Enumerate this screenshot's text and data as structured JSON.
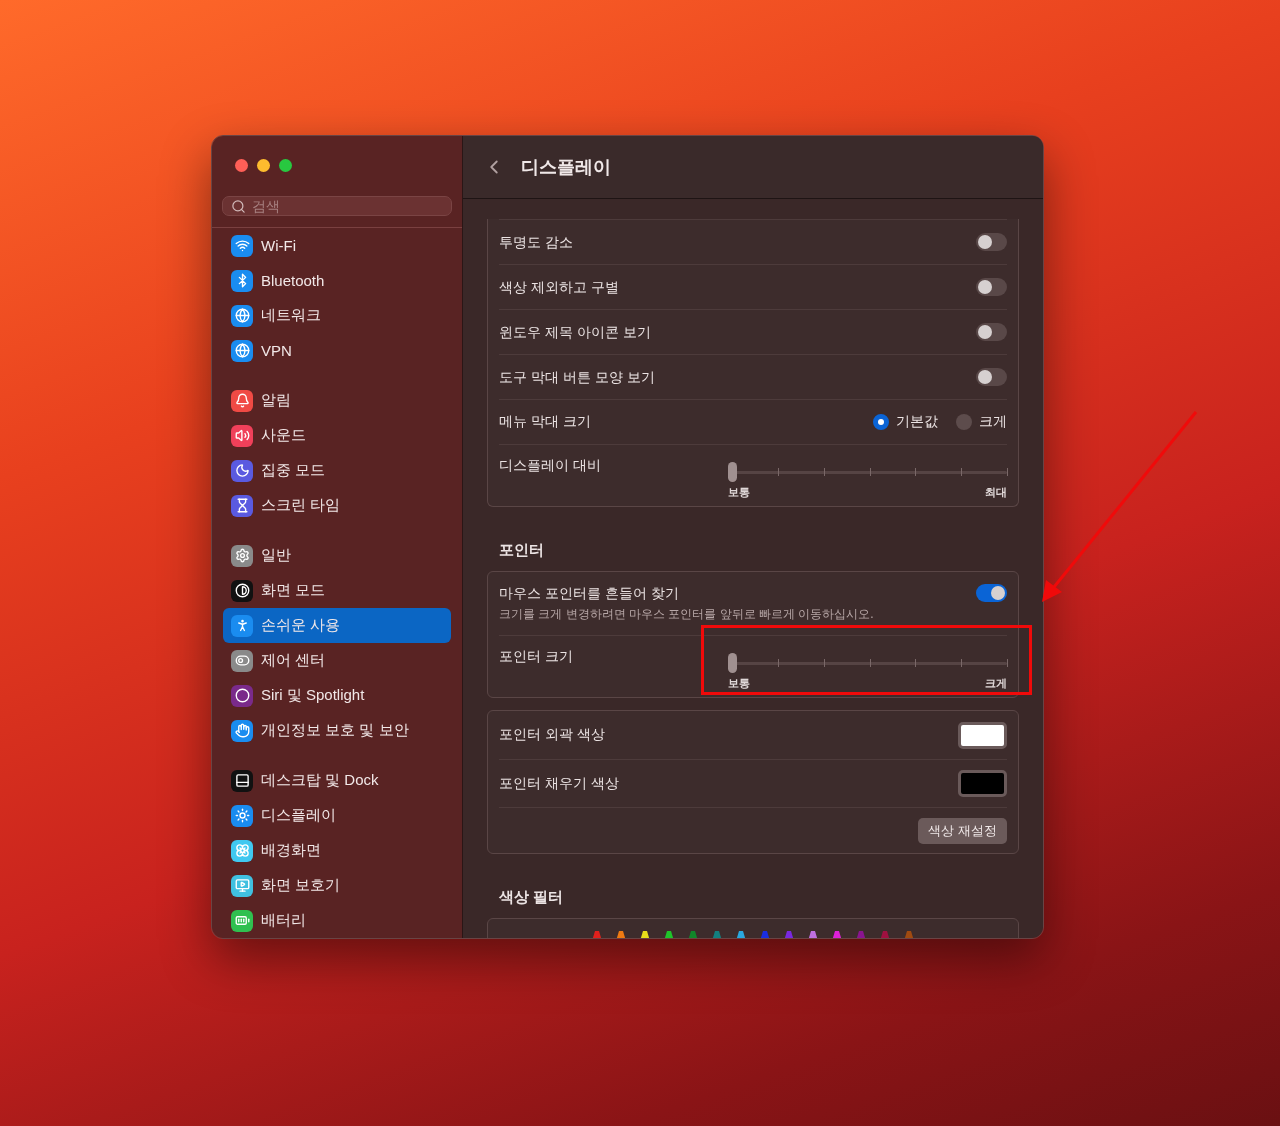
{
  "window": {
    "title": "디스플레이"
  },
  "sidebar": {
    "search": {
      "placeholder": "검색"
    },
    "groups": [
      [
        {
          "label": "Wi-Fi",
          "selected": false
        },
        {
          "label": "Bluetooth",
          "selected": false
        },
        {
          "label": "네트워크",
          "selected": false
        },
        {
          "label": "VPN",
          "selected": false
        }
      ],
      [
        {
          "label": "알림",
          "selected": false
        },
        {
          "label": "사운드",
          "selected": false
        },
        {
          "label": "집중 모드",
          "selected": false
        },
        {
          "label": "스크린 타임",
          "selected": false
        }
      ],
      [
        {
          "label": "일반",
          "selected": false
        },
        {
          "label": "화면 모드",
          "selected": false
        },
        {
          "label": "손쉬운 사용",
          "selected": true
        },
        {
          "label": "제어 센터",
          "selected": false
        },
        {
          "label": "Siri 및 Spotlight",
          "selected": false
        },
        {
          "label": "개인정보 보호 및 보안",
          "selected": false
        }
      ],
      [
        {
          "label": "데스크탑 및 Dock",
          "selected": false
        },
        {
          "label": "디스플레이",
          "selected": false
        },
        {
          "label": "배경화면",
          "selected": false
        },
        {
          "label": "화면 보호기",
          "selected": false
        },
        {
          "label": "배터리",
          "selected": false
        }
      ]
    ]
  },
  "sections": [
    {
      "rows": [
        {
          "kind": "toggle",
          "label": "투명도 감소",
          "on": false
        },
        {
          "kind": "toggle",
          "label": "색상 제외하고 구별",
          "on": false
        },
        {
          "kind": "toggle",
          "label": "윈도우 제목 아이콘 보기",
          "on": false
        },
        {
          "kind": "toggle",
          "label": "도구 막대 버튼 모양 보기",
          "on": false
        },
        {
          "kind": "radio",
          "label": "메뉴 막대 크기",
          "options": [
            {
              "label": "기본값",
              "selected": true
            },
            {
              "label": "크게",
              "selected": false
            }
          ]
        },
        {
          "kind": "slider",
          "label": "디스플레이 대비",
          "level": 0,
          "min_label": "보통",
          "max_label": "최대"
        }
      ]
    },
    {
      "title": "포인터",
      "rows": [
        {
          "kind": "toggle",
          "label": "마우스 포인터를 흔들어 찾기",
          "description": "크기를 크게 변경하려면 마우스 포인터를 앞뒤로 빠르게 이동하십시오.",
          "on": true
        },
        {
          "kind": "slider",
          "label": "포인터 크기",
          "level": 0,
          "min_label": "보통",
          "max_label": "크게"
        }
      ]
    },
    {
      "rows": [
        {
          "kind": "color",
          "label": "포인터 외곽 색상",
          "color": "#ffffff"
        },
        {
          "kind": "color",
          "label": "포인터 채우기 색상",
          "color": "#000000"
        },
        {
          "kind": "button",
          "label": "색상 재설정"
        }
      ]
    },
    {
      "title": "색상 필터",
      "rows": [
        {
          "kind": "crayons",
          "crayons": [
            {
              "color": "#e0201c"
            },
            {
              "color": "#f07a12"
            },
            {
              "color": "#e8de1a"
            },
            {
              "color": "#1fc42a"
            },
            {
              "color": "#11862a"
            },
            {
              "color": "#138080"
            },
            {
              "color": "#2aa8e0"
            },
            {
              "color": "#1a2ee0"
            },
            {
              "color": "#7a28e0"
            },
            {
              "color": "#c070e0"
            },
            {
              "color": "#e020d8"
            },
            {
              "color": "#8a1490"
            },
            {
              "color": "#a01040"
            },
            {
              "color": "#a04a10"
            }
          ]
        }
      ]
    }
  ]
}
